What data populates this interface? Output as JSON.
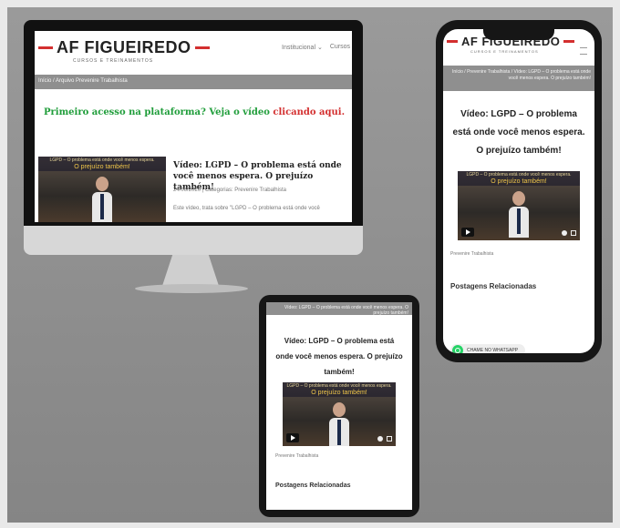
{
  "colors": {
    "accent_red": "#d32f2f",
    "promo_green": "#1f9d3a",
    "breadcrumb_bg": "#8f8f8f",
    "whatsapp": "#25d366"
  },
  "site": {
    "brand": "AF FIGUEIREDO",
    "tagline": "CURSOS E TREINAMENTOS",
    "nav": [
      "Institucional ⌄",
      "Cursos"
    ]
  },
  "desktop": {
    "breadcrumb": "Início / Arquivo Prevenire Trabalhista",
    "promo_text": "Primeiro acesso na plataforma? Veja o vídeo",
    "promo_link": "clicando aqui.",
    "post": {
      "title": "Vídeo: LGPD – O problema está onde você menos espera. O prejuízo também!",
      "meta": "24/06/2020 | Categorias: Prevenire Trabalhista",
      "excerpt": "Este vídeo, trata sobre \"LGPD – O problema está onde você"
    }
  },
  "video_thumb": {
    "title_line1": "LGPD – O problema está onde você menos espera.",
    "title_line2": "O prejuízo também!"
  },
  "phone": {
    "breadcrumb": "Início / Prevenire Trabalhista / Vídeo: LGPD – O problema está onde você menos espera. O prejuízo também!",
    "post_title": "Vídeo: LGPD – O problema está onde você menos espera. O prejuízo também!",
    "category": "Prevenire Trabalhista",
    "related": "Postagens Relacionadas",
    "whatsapp_label": "CHAME NO WHATSAPP"
  },
  "tablet": {
    "breadcrumb": "Vídeo: LGPD – O problema está onde você menos espera. O prejuízo também!",
    "post_title": "Vídeo: LGPD – O problema está onde você menos espera. O prejuízo também!",
    "category": "Prevenire Trabalhista",
    "related": "Postagens Relacionadas"
  }
}
